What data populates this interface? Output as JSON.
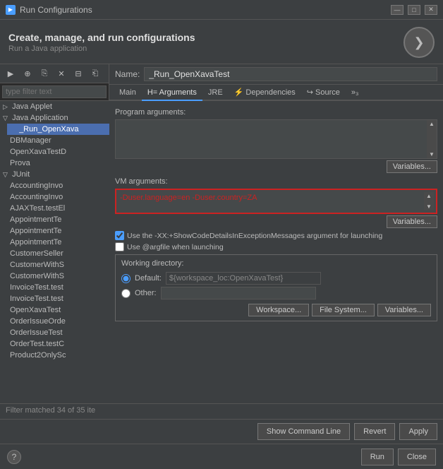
{
  "window": {
    "title": "Run Configurations",
    "icon": "▶"
  },
  "titlebar": {
    "minimize": "—",
    "maximize": "□",
    "close": "✕"
  },
  "header": {
    "title": "Create, manage, and run configurations",
    "subtitle": "Run a Java application",
    "arrow": "❯"
  },
  "toolbar": {
    "buttons": [
      "▶",
      "⊕",
      "⎘",
      "✕",
      "⊟",
      "⎗"
    ]
  },
  "sidebar": {
    "filter_placeholder": "type filter text",
    "tree": [
      {
        "label": "Java Applet",
        "level": 0,
        "expanded": false
      },
      {
        "label": "Java Application",
        "level": 0,
        "expanded": true
      },
      {
        "label": "_Run_OpenXava",
        "level": 1,
        "selected": true
      },
      {
        "label": "DBManager",
        "level": 1
      },
      {
        "label": "OpenXavaTestD",
        "level": 1
      },
      {
        "label": "Prova",
        "level": 1
      },
      {
        "label": "JUnit",
        "level": 0,
        "expanded": true
      },
      {
        "label": "AccountingInvo",
        "level": 1
      },
      {
        "label": "AccountingInvo",
        "level": 1
      },
      {
        "label": "AJAXTest.testEl",
        "level": 1
      },
      {
        "label": "AppointmentTe",
        "level": 1
      },
      {
        "label": "AppointmentTe",
        "level": 1
      },
      {
        "label": "AppointmentTe",
        "level": 1
      },
      {
        "label": "CustomerSeller",
        "level": 1
      },
      {
        "label": "CustomerWithS",
        "level": 1
      },
      {
        "label": "CustomerWithS",
        "level": 1
      },
      {
        "label": "InvoiceTest.test",
        "level": 1
      },
      {
        "label": "InvoiceTest.test",
        "level": 1
      },
      {
        "label": "OpenXavaTest",
        "level": 1
      },
      {
        "label": "OrderIssueOrde",
        "level": 1
      },
      {
        "label": "OrderIssueTest",
        "level": 1
      },
      {
        "label": "OrderTest.testC",
        "level": 1
      },
      {
        "label": "Product2OnlySc",
        "level": 1
      }
    ],
    "filter_status": "Filter matched 34 of 35 ite"
  },
  "content": {
    "name_label": "Name:",
    "name_value": "_Run_OpenXavaTest",
    "tabs": [
      {
        "id": "main",
        "label": "Main"
      },
      {
        "id": "arguments",
        "label": "Arguments",
        "active": true,
        "prefix": "H="
      },
      {
        "id": "jre",
        "label": "JRE"
      },
      {
        "id": "dependencies",
        "label": "Dependencies",
        "prefix": "⚡"
      },
      {
        "id": "source",
        "label": "Source",
        "prefix": "↪"
      },
      {
        "id": "more",
        "label": "»3"
      }
    ],
    "program_args": {
      "label": "Program arguments:",
      "value": "",
      "variables_btn": "Variables..."
    },
    "vm_args": {
      "label": "VM arguments:",
      "value": "-Duser.language=en -Duser.country=ZA",
      "variables_btn": "Variables..."
    },
    "checkboxes": [
      {
        "id": "show_code_details",
        "label": "Use the -XX:+ShowCodeDetailsInExceptionMessages argument for launching",
        "checked": true
      },
      {
        "id": "use_argfile",
        "label": "Use @argfile when launching",
        "checked": false
      }
    ],
    "working_dir": {
      "title": "Working directory:",
      "default_label": "Default:",
      "default_value": "${workspace_loc:OpenXavaTest}",
      "other_label": "Other:",
      "other_value": "",
      "default_selected": true,
      "other_selected": false,
      "buttons": [
        "Workspace...",
        "File System...",
        "Variables..."
      ]
    }
  },
  "action_buttons": {
    "show_command_line": "Show Command Line",
    "revert": "Revert",
    "apply": "Apply"
  },
  "bottom": {
    "help_icon": "?",
    "run_btn": "Run",
    "close_btn": "Close"
  }
}
